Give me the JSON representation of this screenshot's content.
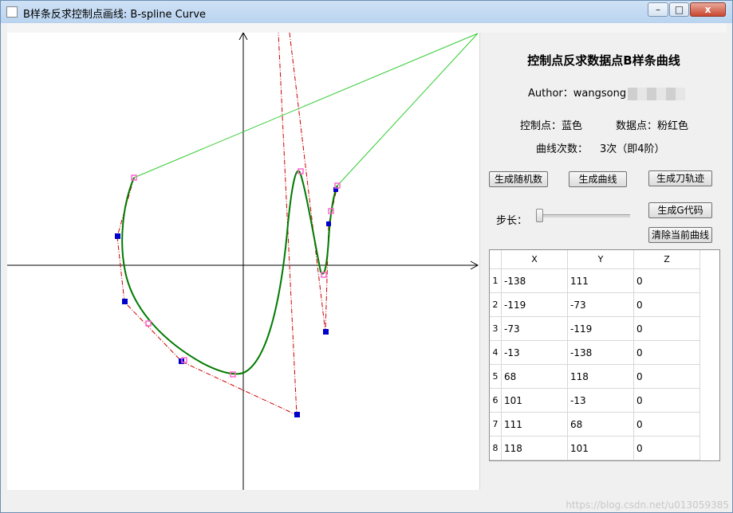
{
  "window": {
    "title": "B样条反求控制点画线: B-spline Curve",
    "controls": {
      "minimize": "–",
      "maximize": "□",
      "close": "x"
    }
  },
  "panel": {
    "heading": "控制点反求数据点B样条曲线",
    "author_label": "Author：wangsong",
    "control_point_legend": "控制点：蓝色",
    "data_point_legend": "数据点：粉红色",
    "degree_label": "曲线次数：",
    "degree_value": "3次（即4阶）",
    "buttons": {
      "random": "生成随机数",
      "curve": "生成曲线",
      "toolpath": "生成刀轨迹",
      "gcode": "生成G代码",
      "clear": "清除当前曲线"
    },
    "step_label": "步长：",
    "step_value": 0
  },
  "table": {
    "headers": [
      "X",
      "Y",
      "Z"
    ],
    "rows": [
      {
        "index": "1",
        "x": "-138",
        "y": "111",
        "z": "0"
      },
      {
        "index": "2",
        "x": "-119",
        "y": "-73",
        "z": "0"
      },
      {
        "index": "3",
        "x": "-73",
        "y": "-119",
        "z": "0"
      },
      {
        "index": "4",
        "x": "-13",
        "y": "-138",
        "z": "0"
      },
      {
        "index": "5",
        "x": "68",
        "y": "118",
        "z": "0"
      },
      {
        "index": "6",
        "x": "101",
        "y": "-13",
        "z": "0"
      },
      {
        "index": "7",
        "x": "111",
        "y": "68",
        "z": "0"
      },
      {
        "index": "8",
        "x": "118",
        "y": "101",
        "z": "0"
      }
    ]
  },
  "watermark": "https://blog.csdn.net/u013059385",
  "colors": {
    "control_points": "#0000cc",
    "data_points": "#ff66cc",
    "control_polygon": "#cc0000",
    "curve": "#007a00",
    "tangent_lines": "#33cc33",
    "axes": "#000000"
  }
}
